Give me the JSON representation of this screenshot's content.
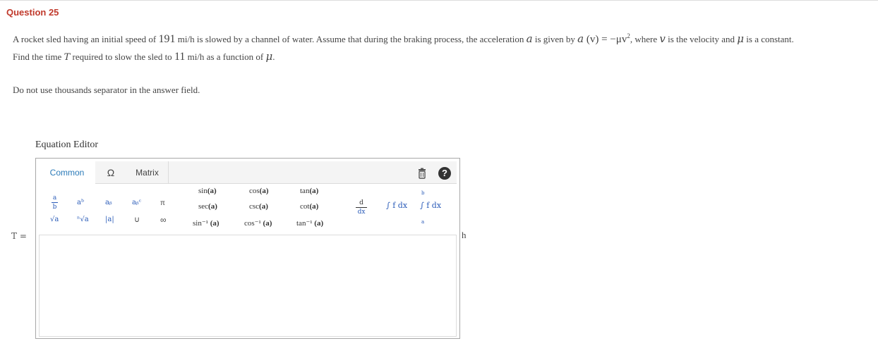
{
  "question": {
    "title": "Question 25",
    "line1": {
      "t1": "A rocket sled having an initial speed of ",
      "v0": "191",
      "t2": " mi/h is slowed by a channel of water. Assume that during the braking process, the acceleration ",
      "a": "a",
      "t3": " is given by ",
      "formula_a": "a",
      "formula_v": "(v)",
      "formula_eq": " = −μv",
      "formula_sup": "2",
      "t4": ", where ",
      "v": "v",
      "t5": " is the velocity and ",
      "mu": "μ",
      "t6": " is a constant."
    },
    "line2": {
      "t1": "Find the time ",
      "tau": "T",
      "t2": " required to slow the sled to ",
      "v1": "11",
      "t3": " mi/h as a function of ",
      "mu": "μ",
      "t4": "."
    },
    "note": "Do not use thousands separator in the answer field."
  },
  "editor": {
    "label": "Equation Editor",
    "tabs": {
      "common": "Common",
      "omega": "Ω",
      "matrix": "Matrix"
    },
    "palette": {
      "frac_num": "a",
      "frac_den": "b",
      "power": "aᵇ",
      "subscript": "aᵦ",
      "subsup": "aᵦᶜ",
      "pi": "π",
      "sqrt": "√a",
      "nthroot": "ⁿ√a",
      "abs": "|a|",
      "union": "∪",
      "infinity": "∞",
      "sin": "sin",
      "cos": "cos",
      "tan": "tan",
      "sec": "sec",
      "csc": "csc",
      "cot": "cot",
      "asin": "sin⁻¹",
      "acos": "cos⁻¹",
      "atan": "tan⁻¹",
      "arg": "(a)",
      "deriv_num": "d",
      "deriv_den": "dx",
      "integral": "∫ f dx",
      "int_upper": "b",
      "int_lower": "a",
      "def_integral": "∫ f dx"
    },
    "help_glyph": "?",
    "answer_value": ""
  },
  "answer_label": "T =",
  "unit": "h"
}
